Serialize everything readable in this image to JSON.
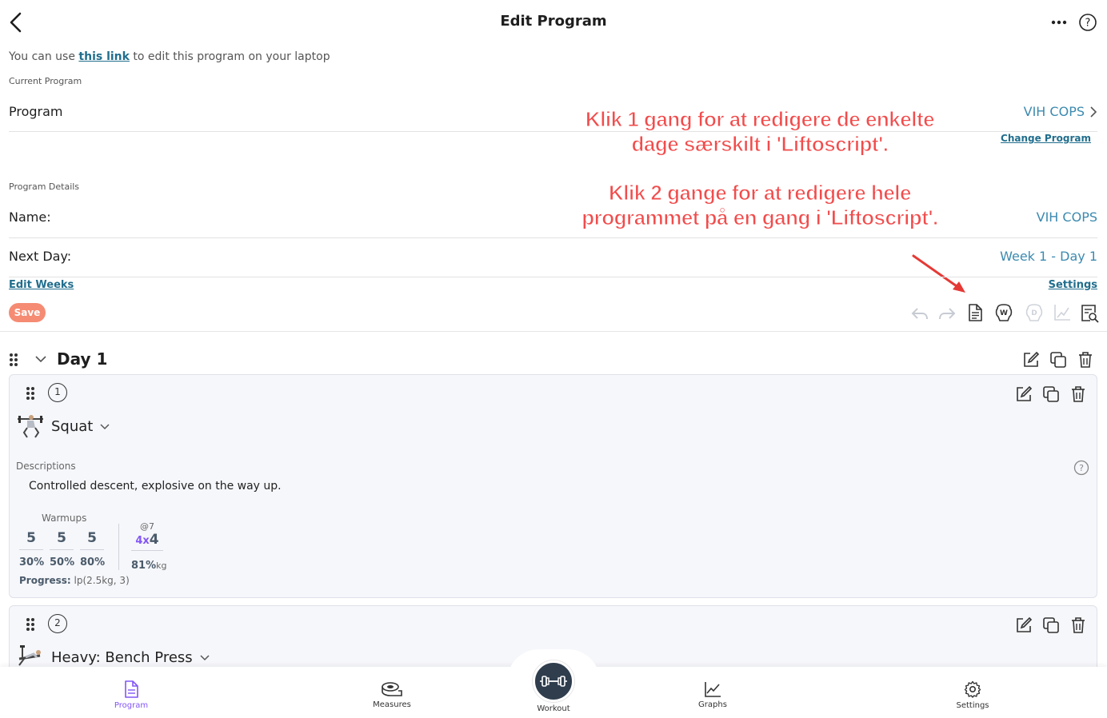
{
  "header": {
    "title": "Edit Program"
  },
  "intro": {
    "prefix": "You can use ",
    "link": "this link",
    "suffix": " to edit this program on your laptop"
  },
  "current_program": {
    "section_label": "Current Program",
    "program_label": "Program",
    "program_value": "VIH COPS",
    "change_link": "Change Program"
  },
  "annotation": {
    "line1": "Klik 1 gang for at redigere de enkelte",
    "line2": "dage særskilt i 'Liftoscript'.",
    "line3": "Klik 2 gange for at redigere hele",
    "line4": "programmet på en gang i 'Liftoscript'.",
    "color": "#f24c4c"
  },
  "program_details": {
    "section_label": "Program Details",
    "name_label": "Name:",
    "name_value": "VIH COPS",
    "next_day_label": "Next Day:",
    "next_day_value": "Week 1 - Day 1",
    "edit_weeks": "Edit Weeks",
    "settings": "Settings",
    "save": "Save"
  },
  "day": {
    "title": "Day 1"
  },
  "exercises": [
    {
      "number": "1",
      "name": "Squat",
      "descriptions_label": "Descriptions",
      "description": "Controlled descent, explosive on the way up.",
      "warmups_label": "Warmups",
      "warmups": [
        {
          "reps": "5",
          "pct": "30%"
        },
        {
          "reps": "5",
          "pct": "50%"
        },
        {
          "reps": "5",
          "pct": "80%"
        }
      ],
      "rpe": "@7",
      "sets": "4x",
      "reps": "4",
      "work_pct": "81%",
      "work_unit": "kg",
      "progress_label": "Progress:",
      "progress_value": "lp(2.5kg, 3)"
    },
    {
      "number": "2",
      "name": "Heavy: Bench Press"
    }
  ],
  "nav": {
    "program": "Program",
    "measures": "Measures",
    "workout": "Workout",
    "graphs": "Graphs",
    "settings": "Settings",
    "active_color": "#8356f6"
  }
}
